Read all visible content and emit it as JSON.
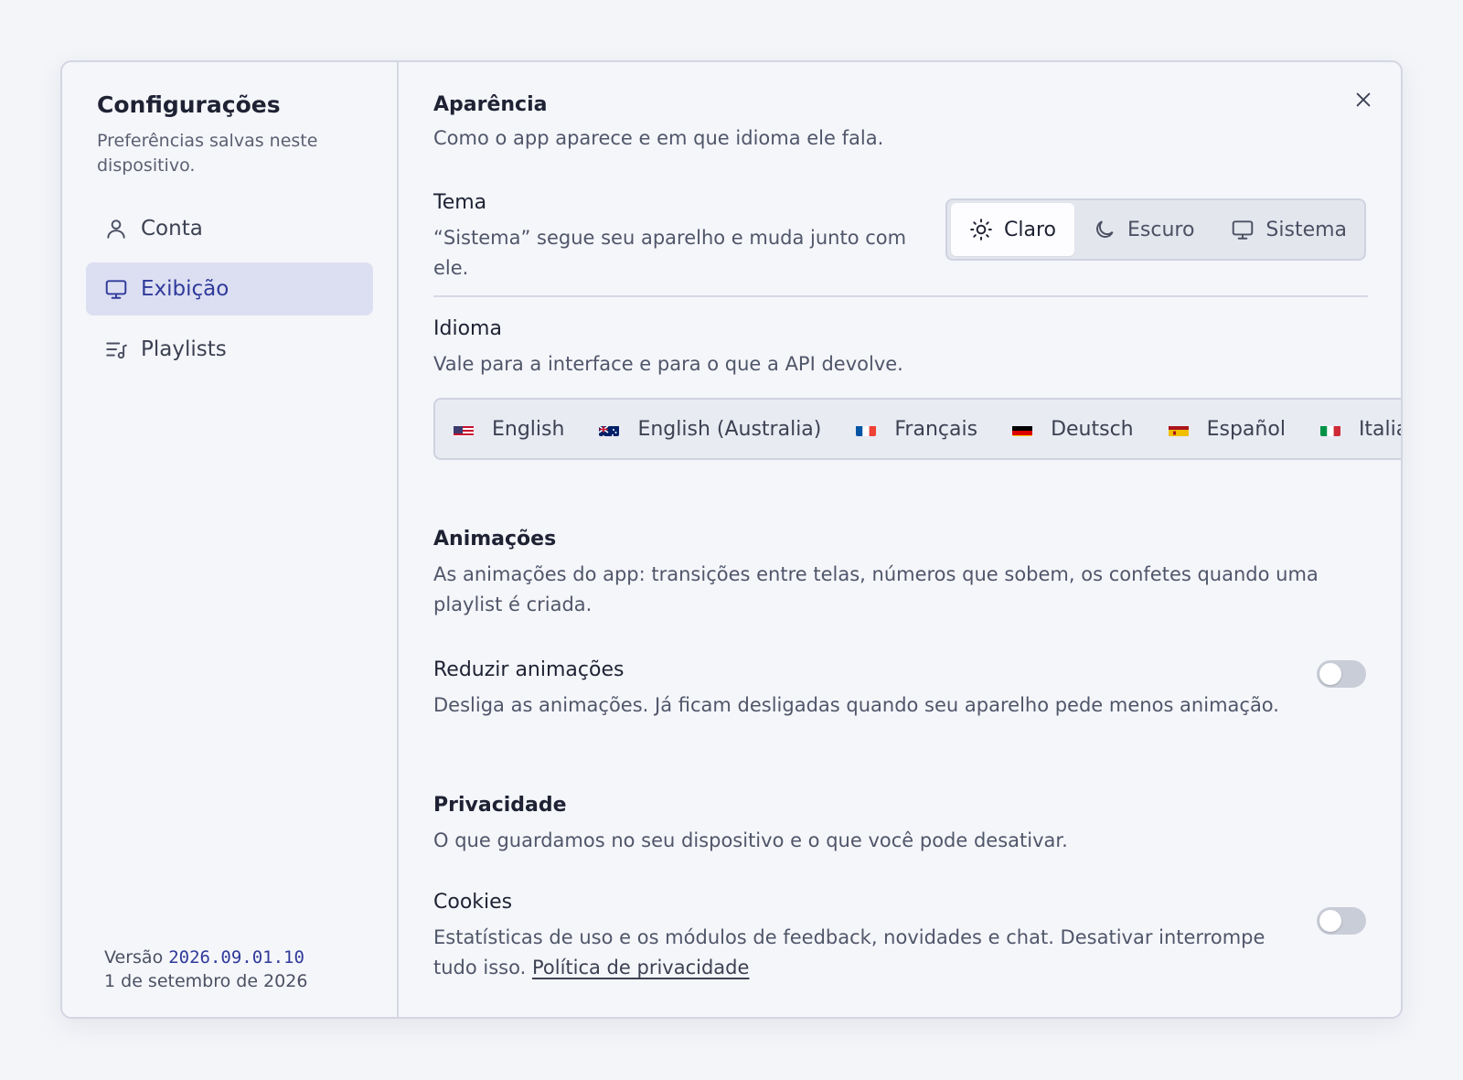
{
  "sidebar": {
    "title": "Configurações",
    "subtitle": "Preferências salvas neste dispositivo.",
    "items": [
      {
        "label": "Conta",
        "icon": "user-icon",
        "active": false
      },
      {
        "label": "Exibição",
        "icon": "monitor-icon",
        "active": true
      },
      {
        "label": "Playlists",
        "icon": "playlist-icon",
        "active": false
      }
    ],
    "version_label": "Versão",
    "version_value": "2026.09.01.10",
    "version_date": "1 de setembro de 2026"
  },
  "appearance": {
    "title": "Aparência",
    "description": "Como o app aparece e em que idioma ele fala."
  },
  "theme": {
    "title": "Tema",
    "description": "“Sistema” segue seu aparelho e muda junto com ele.",
    "options": [
      {
        "label": "Claro",
        "icon": "sun-icon",
        "selected": true
      },
      {
        "label": "Escuro",
        "icon": "moon-icon",
        "selected": false
      },
      {
        "label": "Sistema",
        "icon": "monitor-icon",
        "selected": false
      }
    ]
  },
  "language": {
    "title": "Idioma",
    "description": "Vale para a interface e para o que a API devolve.",
    "options": [
      {
        "label": "English",
        "flag": "us-flag"
      },
      {
        "label": "English (Australia)",
        "flag": "au-flag"
      },
      {
        "label": "Français",
        "flag": "fr-flag"
      },
      {
        "label": "Deutsch",
        "flag": "de-flag"
      },
      {
        "label": "Español",
        "flag": "es-flag"
      },
      {
        "label": "Italia",
        "flag": "it-flag"
      }
    ]
  },
  "animations": {
    "title": "Animações",
    "description": "As animações do app: transições entre telas, números que sobem, os confetes quando uma playlist é criada.",
    "reduce": {
      "title": "Reduzir animações",
      "description": "Desliga as animações. Já ficam desligadas quando seu aparelho pede menos animação.",
      "enabled": false
    }
  },
  "privacy": {
    "title": "Privacidade",
    "description": "O que guardamos no seu dispositivo e o que você pode desativar.",
    "cookies": {
      "title": "Cookies",
      "description": "Estatísticas de uso e os módulos de feedback, novidades e chat. Desativar interrompe tudo isso.",
      "link": "Política de privacidade",
      "enabled": false
    }
  },
  "colors": {
    "accent": "#2f3a9a",
    "active_bg": "#dcdff2",
    "toggle_off": "#c9cdd8"
  }
}
